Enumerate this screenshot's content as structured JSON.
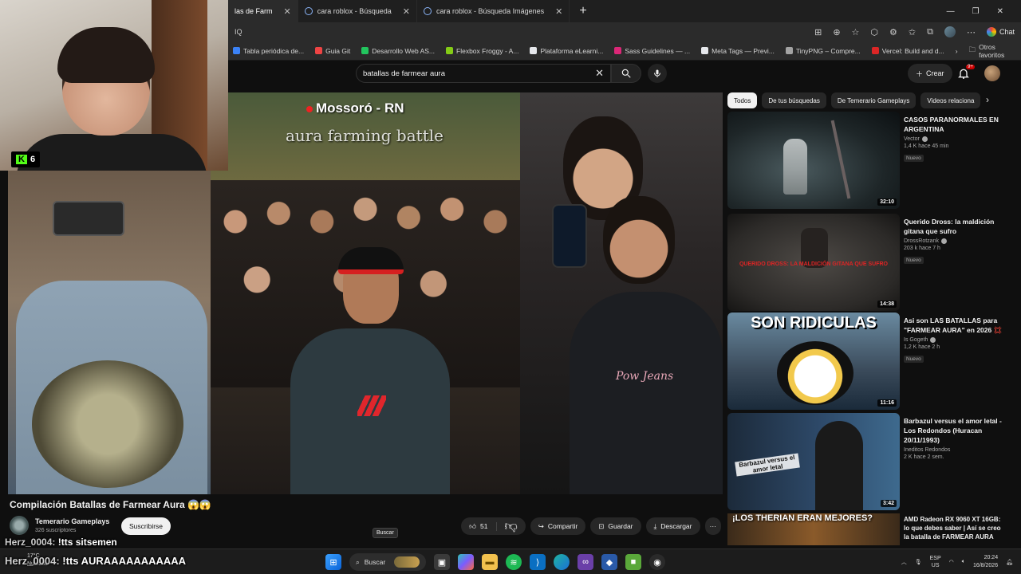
{
  "browser": {
    "tabs": [
      {
        "label": "las de Farm",
        "active": true
      },
      {
        "label": "cara roblox - Búsqueda",
        "active": false
      },
      {
        "label": "cara roblox - Búsqueda Imágenes",
        "active": false
      }
    ],
    "new_tab": "+",
    "address": "IQ",
    "chat_label": "Chat",
    "bookmarks": [
      {
        "label": "Tabla periódica de...",
        "color": "#3b82f6"
      },
      {
        "label": "Guia Git",
        "color": "#ef4444"
      },
      {
        "label": "Desarrollo Web AS...",
        "color": "#22c55e"
      },
      {
        "label": "Flexbox Froggy - A...",
        "color": "#84cc16"
      },
      {
        "label": "Plataforma eLearni...",
        "color": "#e5e7eb"
      },
      {
        "label": "Sass Guidelines — ...",
        "color": "#db2777"
      },
      {
        "label": "Meta Tags — Previ...",
        "color": "#e5e7eb"
      },
      {
        "label": "TinyPNG – Compre...",
        "color": "#a3a3a3"
      },
      {
        "label": "Vercel: Build and d...",
        "color": "#dc2626"
      }
    ],
    "bookmarks_more": "›",
    "other_favorites": "Otros favoritos"
  },
  "youtube": {
    "search_value": "batallas de farmear aura",
    "create_label": "Crear",
    "notif_count": "9+"
  },
  "webcam": {
    "kick_label": "K",
    "viewer_count": "6"
  },
  "video": {
    "overlay_location": "Mossoró - RN",
    "overlay_caption": "aura farming battle",
    "shirt_text": "Pow Jeans",
    "title": "Compilación Batallas de Farmear Aura 😱😱",
    "channel_name": "Temerario Gameplays",
    "channel_subs": "326 suscriptores",
    "subscribe_label": "Suscribirse",
    "likes": "51",
    "share_label": "Compartir",
    "save_label": "Guardar",
    "download_label": "Descargar",
    "more": "···"
  },
  "sidebar": {
    "chips": [
      "Todos",
      "De tus búsquedas",
      "De Temerario Gameplays",
      "Videos relaciona"
    ],
    "recommendations": [
      {
        "title": "CASOS PARANORMALES EN ARGENTINA",
        "channel": "Vector",
        "stats": "1,4 K  hace 45 min",
        "badge": "Nuevo",
        "duration": "32:10",
        "thumb_text": ""
      },
      {
        "title": "Querido Dross: la maldición gitana que sufro",
        "channel": "DrossRotzank",
        "stats": "203 k  hace 7 h",
        "badge": "Nuevo",
        "duration": "14:38",
        "thumb_text": "QUERIDO DROSS: LA MALDICIÓN GITANA QUE SUFRO"
      },
      {
        "title": "Asi son LAS BATALLAS para \"FARMEAR AURA\" en 2026 💢",
        "channel": "Is Gogeth",
        "stats": "1,2 K  hace 2 h",
        "badge": "Nuevo",
        "duration": "11:16",
        "thumb_text": "SON RIDICULAS"
      },
      {
        "title": "Barbazul versus el amor letal - Los Redondos (Huracan 20/11/1993)",
        "channel": "Ineditos Redondos",
        "stats": "2 K  hace 2 sem.",
        "badge": "",
        "duration": "3:42",
        "thumb_text": "Barbazul versus el amor letal"
      }
    ],
    "partial": {
      "thumb_text": "¡LOS THERIAN ERAN MEJORES?",
      "title": "AMD Radeon RX 9060 XT 16GB: lo que debes saber | Así se creo la batalla de FARMEAR AURA"
    }
  },
  "stream_chat": [
    {
      "user": "Herz_0004:",
      "message": "!tts sitsemen"
    },
    {
      "user": "Herz_0004:",
      "message": "!tts AURAAAAAAAAAAA"
    }
  ],
  "tooltip": "Buscar",
  "taskbar": {
    "weather_temp": "17°C",
    "weather_desc": "Nublado",
    "search_label": "Buscar",
    "lang_top": "ESP",
    "lang_bottom": "US",
    "time": "20:24",
    "date": "16/8/2026"
  }
}
